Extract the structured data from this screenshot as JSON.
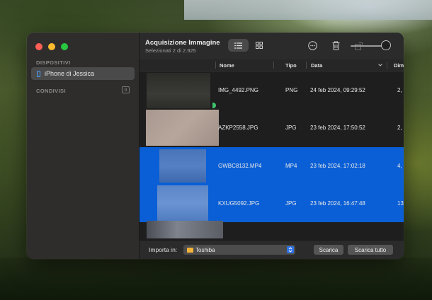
{
  "app": {
    "title": "Acquisizione Immagine",
    "subtitle": "Selezionati 2 di 2.925"
  },
  "sidebar": {
    "devices_label": "DISPOSITIVI",
    "device_name": "iPhone di Jessica",
    "shared_label": "CONDIVISI",
    "shared_count": "0"
  },
  "toolbar": {
    "icons": [
      "list-view-icon",
      "grid-view-icon",
      "more-icon",
      "trash-icon",
      "rotate-icon"
    ]
  },
  "table": {
    "columns": {
      "name": "Nome",
      "type": "Tipo",
      "date": "Data",
      "dimensions": "Dim"
    },
    "rows": [
      {
        "name": "IMG_4492.PNG",
        "type": "PNG",
        "date": "24 feb 2024, 09:29:52",
        "dim": "2,",
        "selected": false
      },
      {
        "name": "AZKP2558.JPG",
        "type": "JPG",
        "date": "23 feb 2024, 17:50:52",
        "dim": "2,",
        "selected": false
      },
      {
        "name": "GWBC8132.MP4",
        "type": "MP4",
        "date": "23 feb 2024, 17:02:18",
        "dim": "4,",
        "selected": true
      },
      {
        "name": "KXUG5092.JPG",
        "type": "JPG",
        "date": "23 feb 2024, 16:47:48",
        "dim": "13",
        "selected": true
      }
    ]
  },
  "bottom": {
    "import_label": "Importa in:",
    "import_destination": "Toshiba",
    "download_button": "Scarica",
    "download_all_button": "Scarica tutto"
  },
  "colors": {
    "selection": "#0a5fd6",
    "accent": "#2d74e6"
  }
}
